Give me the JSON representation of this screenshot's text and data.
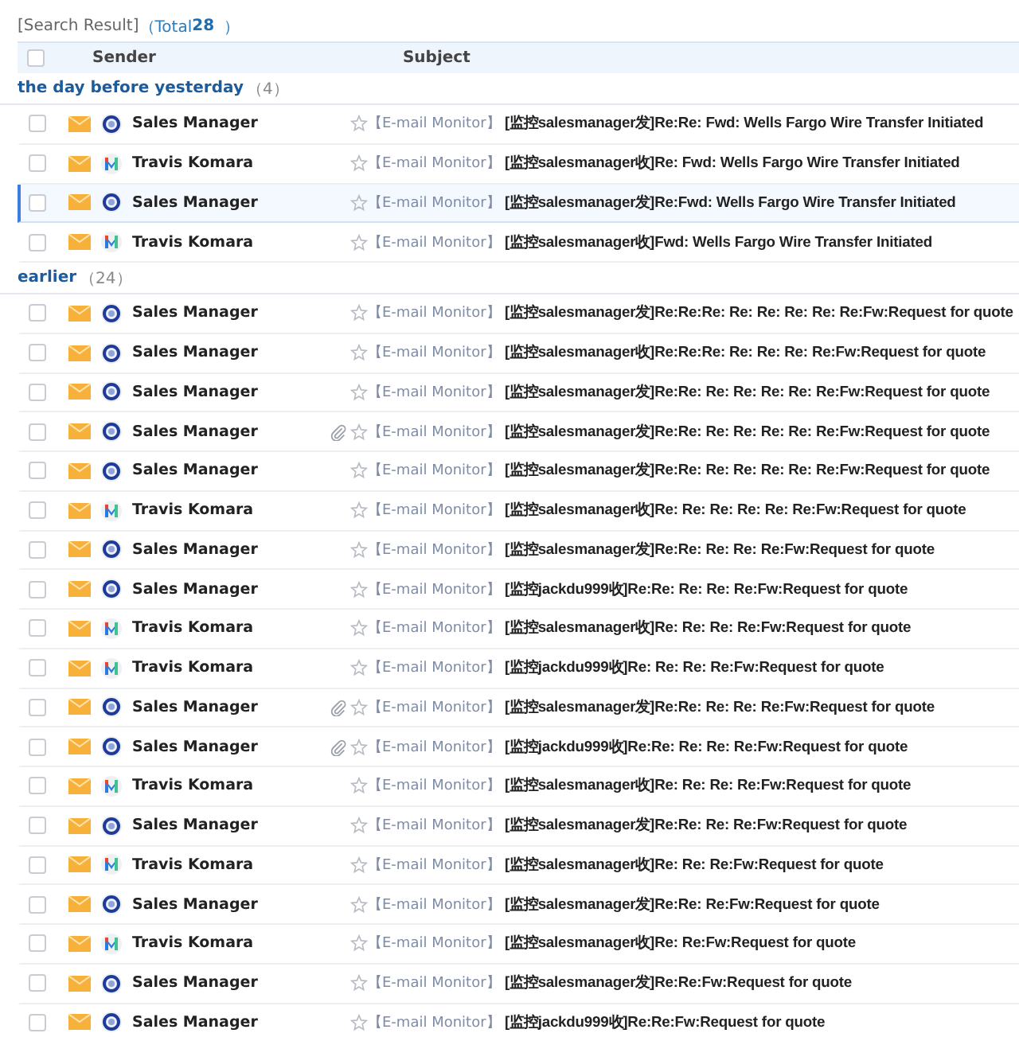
{
  "search_result": {
    "label": "[Search Result]",
    "total_label": "（Total",
    "total": "28",
    "close": "）"
  },
  "columns": {
    "select_all_checked": false,
    "sender": "Sender",
    "subject": "Subject"
  },
  "groups": [
    {
      "title": "the day before yesterday",
      "count": "（4）",
      "rows": [
        {
          "kind": "globe",
          "checked": false,
          "sender": "Sales Manager",
          "attachment": false,
          "selected": false,
          "tag": "【E-mail Monitor】",
          "subject": "[监控salesmanager发]Re:Re: Fwd: Wells Fargo Wire Transfer Initiated"
        },
        {
          "kind": "gradient",
          "checked": false,
          "sender": "Travis Komara",
          "attachment": false,
          "selected": false,
          "tag": "【E-mail Monitor】",
          "subject": "[监控salesmanager收]Re: Fwd: Wells Fargo Wire Transfer Initiated"
        },
        {
          "kind": "globe",
          "checked": false,
          "sender": "Sales Manager",
          "attachment": false,
          "selected": true,
          "tag": "【E-mail Monitor】",
          "subject": "[监控salesmanager发]Re:Fwd: Wells Fargo Wire Transfer Initiated"
        },
        {
          "kind": "gradient",
          "checked": false,
          "sender": "Travis Komara",
          "attachment": false,
          "selected": false,
          "tag": "【E-mail Monitor】",
          "subject": "[监控salesmanager收]Fwd: Wells Fargo Wire Transfer Initiated"
        }
      ]
    },
    {
      "title": "earlier",
      "count": "（24）",
      "rows": [
        {
          "kind": "globe",
          "checked": false,
          "sender": "Sales Manager",
          "attachment": false,
          "selected": false,
          "tag": "【E-mail Monitor】",
          "subject": "[监控salesmanager发]Re:Re:Re: Re: Re: Re: Re: Re:Fw:Request for quote"
        },
        {
          "kind": "globe",
          "checked": false,
          "sender": "Sales Manager",
          "attachment": false,
          "selected": false,
          "tag": "【E-mail Monitor】",
          "subject": "[监控salesmanager收]Re:Re:Re: Re: Re: Re: Re:Fw:Request for quote"
        },
        {
          "kind": "globe",
          "checked": false,
          "sender": "Sales Manager",
          "attachment": false,
          "selected": false,
          "tag": "【E-mail Monitor】",
          "subject": "[监控salesmanager发]Re:Re: Re: Re: Re: Re: Re:Fw:Request for quote"
        },
        {
          "kind": "globe",
          "checked": false,
          "sender": "Sales Manager",
          "attachment": true,
          "selected": false,
          "tag": "【E-mail Monitor】",
          "subject": "[监控salesmanager发]Re:Re: Re: Re: Re: Re: Re:Fw:Request for quote"
        },
        {
          "kind": "globe",
          "checked": false,
          "sender": "Sales Manager",
          "attachment": false,
          "selected": false,
          "tag": "【E-mail Monitor】",
          "subject": "[监控salesmanager发]Re:Re: Re: Re: Re: Re: Re:Fw:Request for quote"
        },
        {
          "kind": "gradient",
          "checked": false,
          "sender": "Travis Komara",
          "attachment": false,
          "selected": false,
          "tag": "【E-mail Monitor】",
          "subject": "[监控salesmanager收]Re: Re: Re: Re: Re: Re:Fw:Request for quote"
        },
        {
          "kind": "globe",
          "checked": false,
          "sender": "Sales Manager",
          "attachment": false,
          "selected": false,
          "tag": "【E-mail Monitor】",
          "subject": "[监控salesmanager发]Re:Re: Re: Re: Re:Fw:Request for quote"
        },
        {
          "kind": "globe",
          "checked": false,
          "sender": "Sales Manager",
          "attachment": false,
          "selected": false,
          "tag": "【E-mail Monitor】",
          "subject": "[监控jackdu999收]Re:Re: Re: Re: Re:Fw:Request for quote"
        },
        {
          "kind": "gradient",
          "checked": false,
          "sender": "Travis Komara",
          "attachment": false,
          "selected": false,
          "tag": "【E-mail Monitor】",
          "subject": "[监控salesmanager收]Re: Re: Re: Re:Fw:Request for quote"
        },
        {
          "kind": "gradient",
          "checked": false,
          "sender": "Travis Komara",
          "attachment": false,
          "selected": false,
          "tag": "【E-mail Monitor】",
          "subject": "[监控jackdu999收]Re: Re: Re: Re:Fw:Request for quote"
        },
        {
          "kind": "globe",
          "checked": false,
          "sender": "Sales Manager",
          "attachment": true,
          "selected": false,
          "tag": "【E-mail Monitor】",
          "subject": "[监控salesmanager发]Re:Re: Re: Re: Re:Fw:Request for quote"
        },
        {
          "kind": "globe",
          "checked": false,
          "sender": "Sales Manager",
          "attachment": true,
          "selected": false,
          "tag": "【E-mail Monitor】",
          "subject": "[监控jackdu999收]Re:Re: Re: Re: Re:Fw:Request for quote"
        },
        {
          "kind": "gradient",
          "checked": false,
          "sender": "Travis Komara",
          "attachment": false,
          "selected": false,
          "tag": "【E-mail Monitor】",
          "subject": "[监控salesmanager收]Re: Re: Re: Re:Fw:Request for quote"
        },
        {
          "kind": "globe",
          "checked": false,
          "sender": "Sales Manager",
          "attachment": false,
          "selected": false,
          "tag": "【E-mail Monitor】",
          "subject": "[监控salesmanager发]Re:Re: Re: Re:Fw:Request for quote"
        },
        {
          "kind": "gradient",
          "checked": false,
          "sender": "Travis Komara",
          "attachment": false,
          "selected": false,
          "tag": "【E-mail Monitor】",
          "subject": "[监控salesmanager收]Re: Re: Re:Fw:Request for quote"
        },
        {
          "kind": "globe",
          "checked": false,
          "sender": "Sales Manager",
          "attachment": false,
          "selected": false,
          "tag": "【E-mail Monitor】",
          "subject": "[监控salesmanager发]Re:Re: Re:Fw:Request for quote"
        },
        {
          "kind": "gradient",
          "checked": false,
          "sender": "Travis Komara",
          "attachment": false,
          "selected": false,
          "tag": "【E-mail Monitor】",
          "subject": "[监控salesmanager收]Re: Re:Fw:Request for quote"
        },
        {
          "kind": "globe",
          "checked": false,
          "sender": "Sales Manager",
          "attachment": false,
          "selected": false,
          "tag": "【E-mail Monitor】",
          "subject": "[监控salesmanager发]Re:Re:Fw:Request for quote"
        },
        {
          "kind": "globe",
          "checked": false,
          "sender": "Sales Manager",
          "attachment": false,
          "selected": false,
          "tag": "【E-mail Monitor】",
          "subject": "[监控jackdu999收]Re:Re:Fw:Request for quote"
        }
      ]
    }
  ]
}
